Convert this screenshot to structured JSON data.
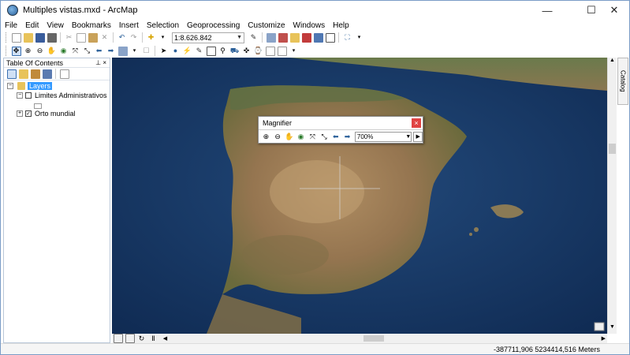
{
  "window": {
    "title": "Multiples vistas.mxd - ArcMap",
    "minimize": "—",
    "maximize": "☐",
    "close": "✕"
  },
  "menu": [
    "File",
    "Edit",
    "View",
    "Bookmarks",
    "Insert",
    "Selection",
    "Geoprocessing",
    "Customize",
    "Windows",
    "Help"
  ],
  "toolbar": {
    "scale_value": "1:8.626.842"
  },
  "toc": {
    "title": "Table Of Contents",
    "pin": "⊥ ×",
    "layers_label": "Layers",
    "layer1": "Limites Administrativos",
    "layer2": "Orto mundial"
  },
  "catalog_tab": "Catalog",
  "magnifier": {
    "title": "Magnifier",
    "zoom": "700%"
  },
  "status": {
    "coords": "-387711,906  5234414,516 Meters"
  }
}
